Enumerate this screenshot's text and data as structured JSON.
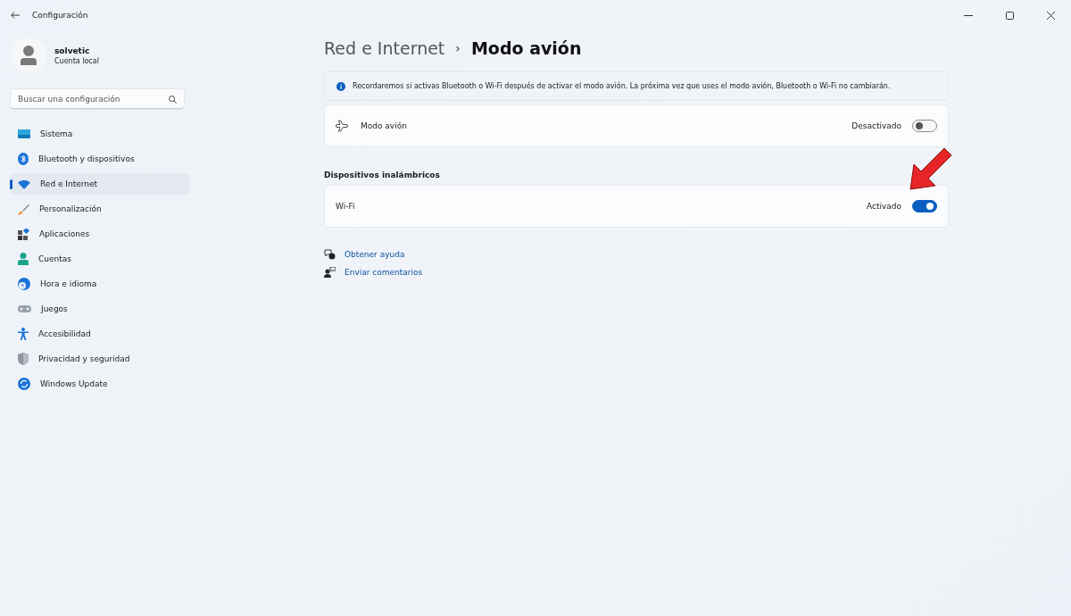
{
  "window": {
    "title": "Configuración"
  },
  "account": {
    "name": "solvetic",
    "type": "Cuenta local"
  },
  "search": {
    "placeholder": "Buscar una configuración"
  },
  "sidebar": {
    "items": [
      {
        "label": "Sistema",
        "selected": false
      },
      {
        "label": "Bluetooth y dispositivos",
        "selected": false
      },
      {
        "label": "Red e Internet",
        "selected": true
      },
      {
        "label": "Personalización",
        "selected": false
      },
      {
        "label": "Aplicaciones",
        "selected": false
      },
      {
        "label": "Cuentas",
        "selected": false
      },
      {
        "label": "Hora e idioma",
        "selected": false
      },
      {
        "label": "Juegos",
        "selected": false
      },
      {
        "label": "Accesibilidad",
        "selected": false
      },
      {
        "label": "Privacidad y seguridad",
        "selected": false
      },
      {
        "label": "Windows Update",
        "selected": false
      }
    ]
  },
  "breadcrumb": {
    "parent": "Red e Internet",
    "separator": "›",
    "current": "Modo avión"
  },
  "info_bar": {
    "text": "Recordaremos si activas Bluetooth o Wi-Fi después de activar el modo avión. La próxima vez que uses el modo avión, Bluetooth o Wi-Fi no cambiarán."
  },
  "airplane_mode": {
    "label": "Modo avión",
    "status": "Desactivado",
    "on": false
  },
  "wireless_section": {
    "title": "Dispositivos inalámbricos",
    "items": [
      {
        "label": "Wi-Fi",
        "status": "Activado",
        "on": true
      }
    ]
  },
  "links": [
    {
      "label": "Obtener ayuda"
    },
    {
      "label": "Enviar comentarios"
    }
  ]
}
